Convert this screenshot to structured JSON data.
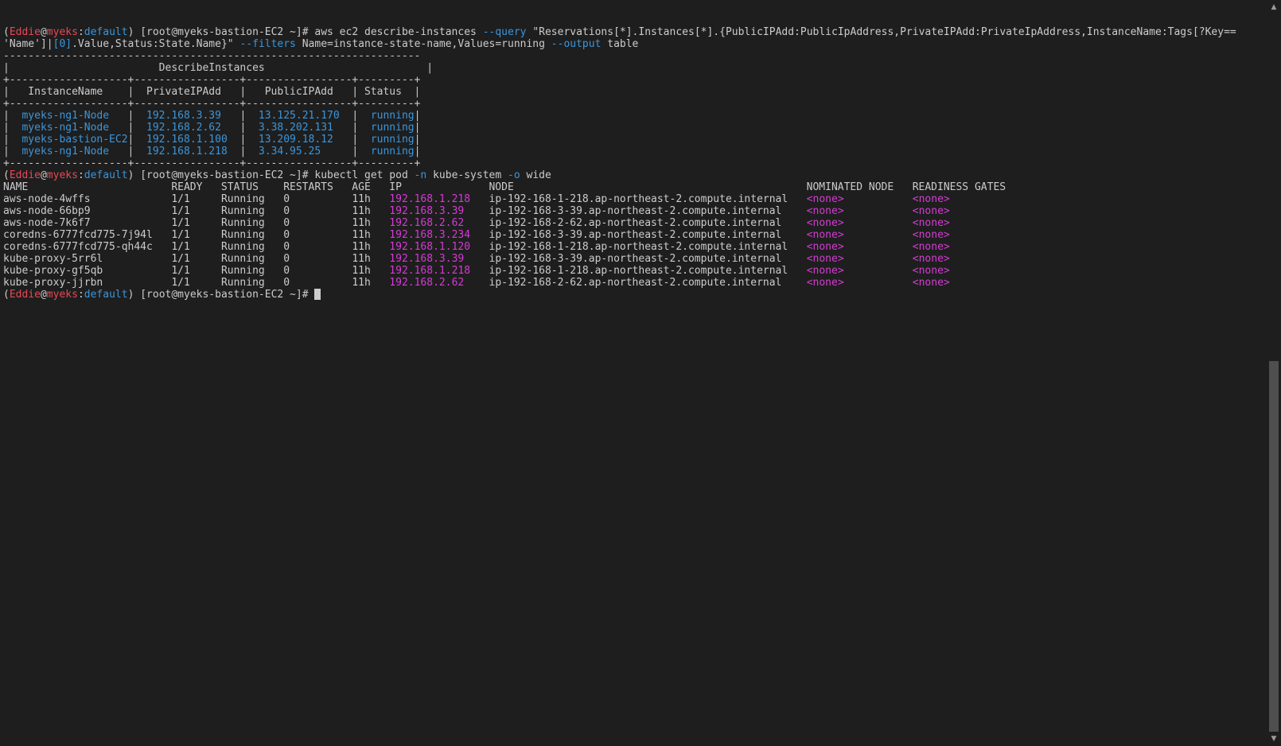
{
  "prompt1": {
    "user": "Eddie",
    "at": "@",
    "host": "myeks",
    "colon": ":",
    "context": "default",
    "rest": ") [root@myeks-bastion-EC2 ~]# "
  },
  "cmd1": {
    "part1": "aws ec2 describe-instances ",
    "query_flag": "--query",
    "part2": " \"Reservations[*].Instances[*].{PublicIPAdd:PublicIpAddress,PrivateIPAdd:PrivateIpAddress,InstanceName:Tags[?Key==",
    "line2_a": "'Name']|",
    "line2_idx": "[0]",
    "line2_b": ".Value,Status:State.Name}\" ",
    "filters_flag": "--filters",
    "line2_c": " Name=instance-state-name,Values=running ",
    "output_flag": "--output",
    "line2_d": " table"
  },
  "table": {
    "border_top": "-------------------------------------------------------------------",
    "title_row": "|                        DescribeInstances                          |",
    "border_mid": "+-------------------+-----------------+-----------------+---------+",
    "header_row": "|   InstanceName    |  PrivateIPAdd   |   PublicIPAdd   | Status  |",
    "rows": [
      {
        "name": "myeks-ng1-Node",
        "private": "192.168.3.39",
        "public": "13.125.21.170",
        "status": "running"
      },
      {
        "name": "myeks-ng1-Node",
        "private": "192.168.2.62",
        "public": "3.38.202.131",
        "status": "running"
      },
      {
        "name": "myeks-bastion-EC2",
        "private": "192.168.1.100",
        "public": "13.209.18.12",
        "status": "running"
      },
      {
        "name": "myeks-ng1-Node",
        "private": "192.168.1.218",
        "public": "3.34.95.25",
        "status": "running"
      }
    ]
  },
  "cmd2": {
    "part1": "kubectl get pod ",
    "n_flag": "-n",
    "part2": " kube-system ",
    "o_flag": "-o",
    "part3": " wide"
  },
  "pods": {
    "headers": {
      "name": "NAME",
      "ready": "READY",
      "status": "STATUS",
      "restarts": "RESTARTS",
      "age": "AGE",
      "ip": "IP",
      "node": "NODE",
      "nominated": "NOMINATED NODE",
      "readiness": "READINESS GATES"
    },
    "rows": [
      {
        "name": "aws-node-4wffs",
        "ready": "1/1",
        "status": "Running",
        "restarts": "0",
        "age": "11h",
        "ip": "192.168.1.218",
        "node": "ip-192-168-1-218.ap-northeast-2.compute.internal",
        "nominated": "<none>",
        "readiness": "<none>"
      },
      {
        "name": "aws-node-66bp9",
        "ready": "1/1",
        "status": "Running",
        "restarts": "0",
        "age": "11h",
        "ip": "192.168.3.39",
        "node": "ip-192-168-3-39.ap-northeast-2.compute.internal",
        "nominated": "<none>",
        "readiness": "<none>"
      },
      {
        "name": "aws-node-7k6f7",
        "ready": "1/1",
        "status": "Running",
        "restarts": "0",
        "age": "11h",
        "ip": "192.168.2.62",
        "node": "ip-192-168-2-62.ap-northeast-2.compute.internal",
        "nominated": "<none>",
        "readiness": "<none>"
      },
      {
        "name": "coredns-6777fcd775-7j94l",
        "ready": "1/1",
        "status": "Running",
        "restarts": "0",
        "age": "11h",
        "ip": "192.168.3.234",
        "node": "ip-192-168-3-39.ap-northeast-2.compute.internal",
        "nominated": "<none>",
        "readiness": "<none>"
      },
      {
        "name": "coredns-6777fcd775-qh44c",
        "ready": "1/1",
        "status": "Running",
        "restarts": "0",
        "age": "11h",
        "ip": "192.168.1.120",
        "node": "ip-192-168-1-218.ap-northeast-2.compute.internal",
        "nominated": "<none>",
        "readiness": "<none>"
      },
      {
        "name": "kube-proxy-5rr6l",
        "ready": "1/1",
        "status": "Running",
        "restarts": "0",
        "age": "11h",
        "ip": "192.168.3.39",
        "node": "ip-192-168-3-39.ap-northeast-2.compute.internal",
        "nominated": "<none>",
        "readiness": "<none>"
      },
      {
        "name": "kube-proxy-gf5qb",
        "ready": "1/1",
        "status": "Running",
        "restarts": "0",
        "age": "11h",
        "ip": "192.168.1.218",
        "node": "ip-192-168-1-218.ap-northeast-2.compute.internal",
        "nominated": "<none>",
        "readiness": "<none>"
      },
      {
        "name": "kube-proxy-jjrbn",
        "ready": "1/1",
        "status": "Running",
        "restarts": "0",
        "age": "11h",
        "ip": "192.168.2.62",
        "node": "ip-192-168-2-62.ap-northeast-2.compute.internal",
        "nominated": "<none>",
        "readiness": "<none>"
      }
    ]
  },
  "scrollbar": {
    "up_icon": "▲",
    "down_icon": "▼"
  },
  "colors": {
    "background": "#1e1e1e",
    "foreground": "#cccccc",
    "prompt_red": "#e74856",
    "flag_blue": "#3a96dd",
    "ip_magenta": "#d63ad6"
  }
}
